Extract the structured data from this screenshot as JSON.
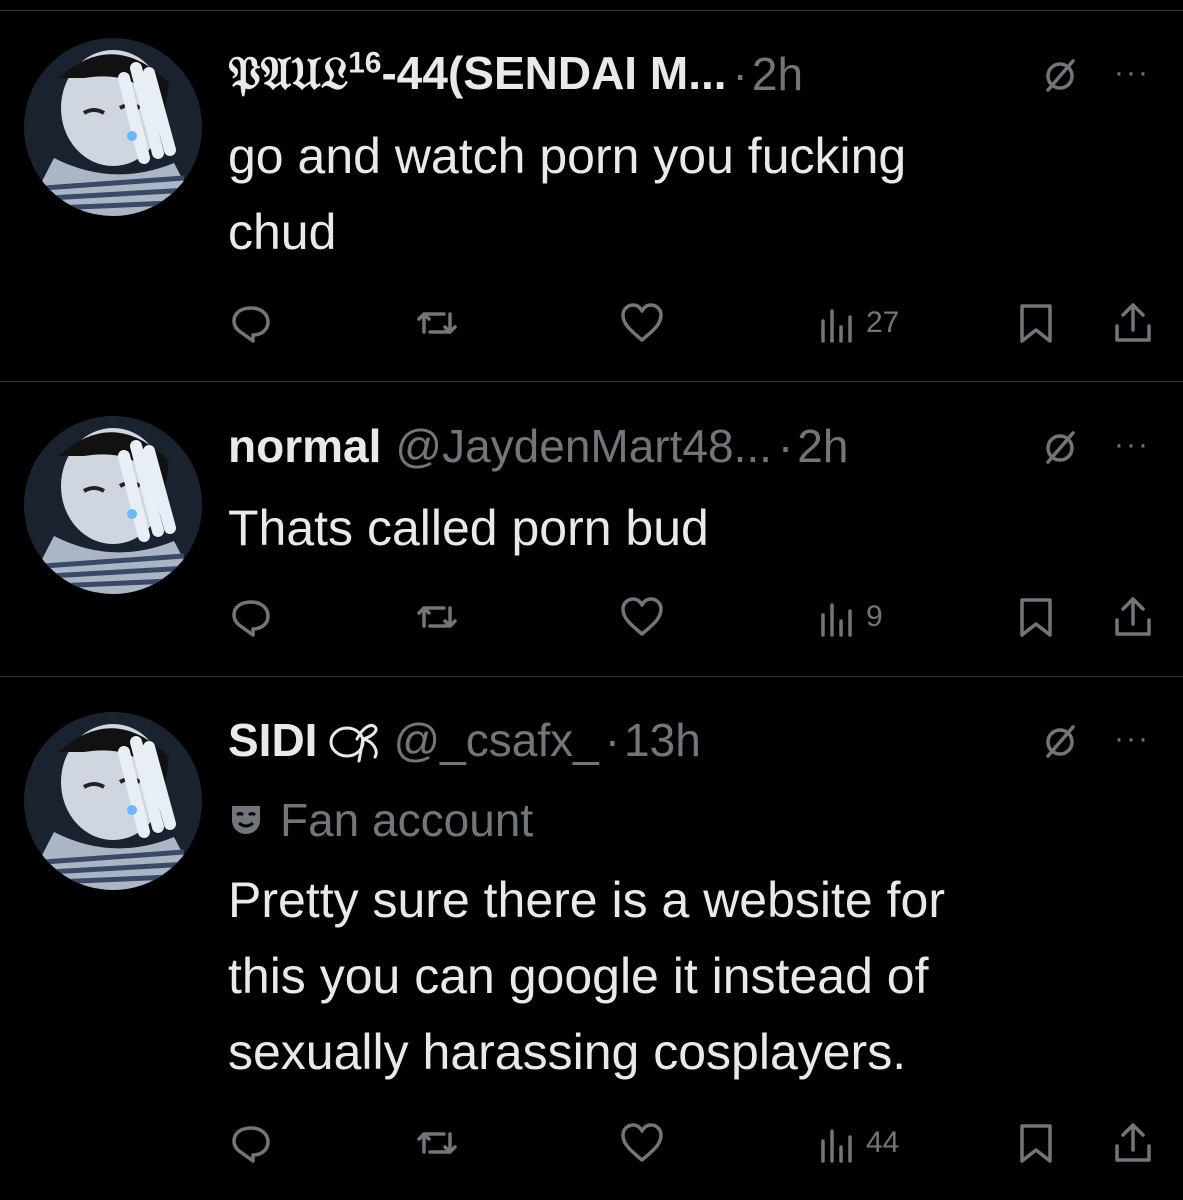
{
  "colors": {
    "background": "#000000",
    "text": "#e7e9ea",
    "muted": "#71767b",
    "divider": "#2f3336"
  },
  "tweets": [
    {
      "name": "𝔓𝔄𝔘𝔏",
      "name_sup": "16",
      "name_rest": "-44(SENDAI M...",
      "handle": "",
      "dot": "·",
      "time": "2h",
      "text_lines": [
        "go and watch porn you fucking",
        "chud"
      ],
      "views": "27",
      "icons": [
        "avatar",
        "grok-icon",
        "more-icon",
        "reply-icon",
        "retweet-icon",
        "like-icon",
        "views-icon",
        "bookmark-icon",
        "share-icon"
      ]
    },
    {
      "name": "normal",
      "handle": "@JaydenMart48...",
      "dot": "·",
      "time": "2h",
      "text_lines": [
        "Thats called porn bud"
      ],
      "views": "9"
    },
    {
      "name": "SIDI",
      "handle": "@_csafx_",
      "dot": "·",
      "time": "13h",
      "label": "Fan account",
      "text_lines": [
        "Pretty sure there is a website for",
        "this you can google it instead of",
        "sexually harassing cosplayers."
      ],
      "views": "44"
    }
  ],
  "more_label": "···"
}
